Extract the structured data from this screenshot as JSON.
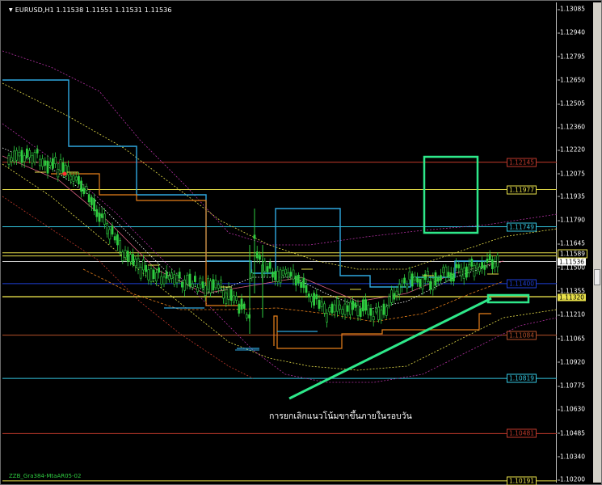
{
  "window": {
    "title_arrow": "▼",
    "symbol_title": "EURUSD,H1  1.11538 1.11551 1.11531 1.11536",
    "indicator_label": "ZZB_Gra384-MtaAR05-02",
    "annotation": "การยกเลิกแนวโน้มขาขึ้นภายในรอบวัน"
  },
  "price_axis": {
    "ticks": [
      "1.13085",
      "1.12940",
      "1.12795",
      "1.12650",
      "1.12505",
      "1.12360",
      "1.12220",
      "1.12075",
      "1.11935",
      "1.11790",
      "1.11645",
      "1.11500",
      "1.11355",
      "1.11210",
      "1.11065",
      "1.10920",
      "1.10775",
      "1.10630",
      "1.10485",
      "1.10340",
      "1.10200"
    ],
    "current_price": "1.11536",
    "ask_price": "1.11589",
    "support_price": "1.11320"
  },
  "levels": [
    {
      "price": "1.12145",
      "color": "#c0392b"
    },
    {
      "price": "1.11977",
      "color": "#e8e04a"
    },
    {
      "price": "1.11749",
      "color": "#33c6e0"
    },
    {
      "price": "1.11400",
      "color": "#1f3fd6"
    },
    {
      "price": "1.11084",
      "color": "#b4502a"
    },
    {
      "price": "1.10819",
      "color": "#33c6e0"
    },
    {
      "price": "1.10481",
      "color": "#c0392b"
    },
    {
      "price": "1.10191",
      "color": "#e8e04a"
    }
  ],
  "colors": {
    "candles": "#2ecc40",
    "trend_line": "#2ee88a",
    "blue_channel": "#2fa8e0",
    "orange_channel": "#e8801a"
  }
}
